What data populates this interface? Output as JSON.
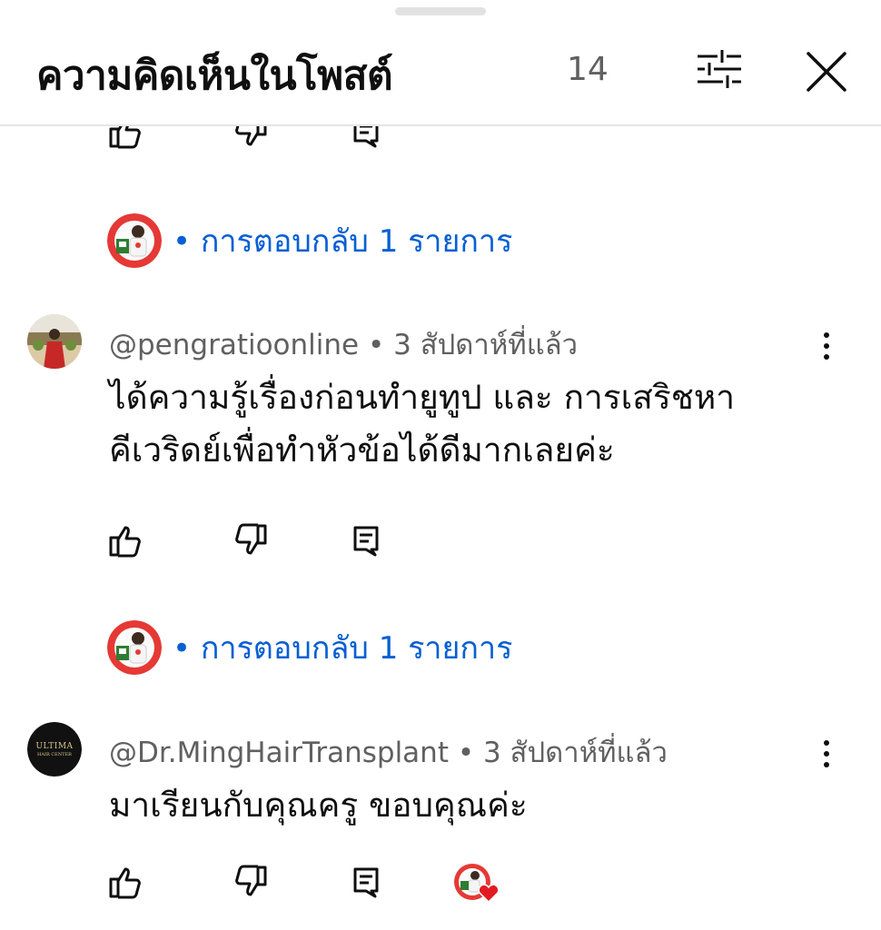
{
  "header": {
    "title": "ความคิดเห็นในโพสต์",
    "count": "14",
    "filter_icon": "sliders-icon",
    "close_icon": "close-icon"
  },
  "replies_label_1": "• การตอบกลับ 1 รายการ",
  "replies_label_2": "• การตอบกลับ 1 รายการ",
  "comments": [
    {
      "author": "@pengratioonline",
      "time": " • 3 สัปดาห์ที่แล้ว",
      "text_lines": [
        "ได้ความรู้เรื่องก่อนทำยูทูป และ การเสริชหา",
        "คีเวริดย์เพื่อทำหัวข้อได้ดีมากเลยค่ะ"
      ]
    },
    {
      "author": "@Dr.MingHairTransplant",
      "time": " • 3 สัปดาห์ที่แล้ว",
      "text_lines": [
        "มาเรียนกับคุณครู ขอบคุณค่ะ"
      ],
      "avatar_text": [
        "ULTIMA",
        "HAIR CENTER"
      ]
    }
  ],
  "colors": {
    "link": "#065fd4",
    "secondary_text": "#606060",
    "heart": "#e21b23"
  }
}
